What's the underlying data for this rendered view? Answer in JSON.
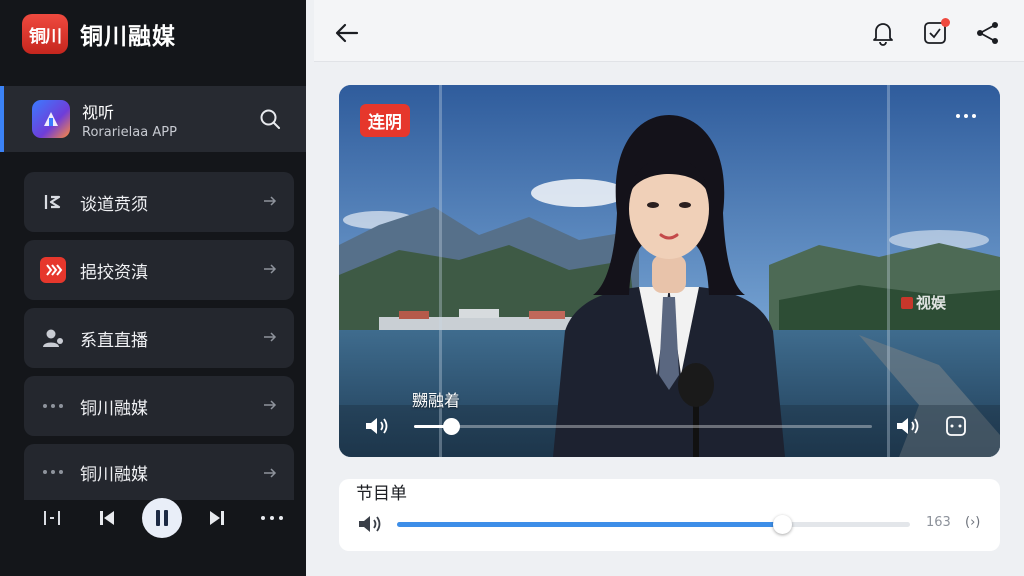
{
  "brand": {
    "logo_text": "铜川",
    "name": "铜川融媒"
  },
  "app_card": {
    "title": "视听",
    "subtitle": "Rorarielaa APP"
  },
  "menu": [
    {
      "label": "谈道贲须",
      "icon": "list-icon"
    },
    {
      "label": "挹挍资滇",
      "icon": "signal-icon"
    },
    {
      "label": "系直直播",
      "icon": "person-icon"
    },
    {
      "label": "铜川融媒",
      "icon": "dots-icon"
    },
    {
      "label": "铜川融媒",
      "icon": "dots-icon"
    }
  ],
  "player": {
    "playing": true
  },
  "video": {
    "badge": "连阴",
    "watermark": "视娱",
    "caption": "嬲融着",
    "progress": 0.08
  },
  "playlist": {
    "title": "节目单",
    "progress": 0.75,
    "count": "163",
    "loop_label": "(›)"
  },
  "colors": {
    "accent": "#3d8ee8",
    "brand_red": "#e6372c",
    "sidebar_bg": "#14161a"
  }
}
